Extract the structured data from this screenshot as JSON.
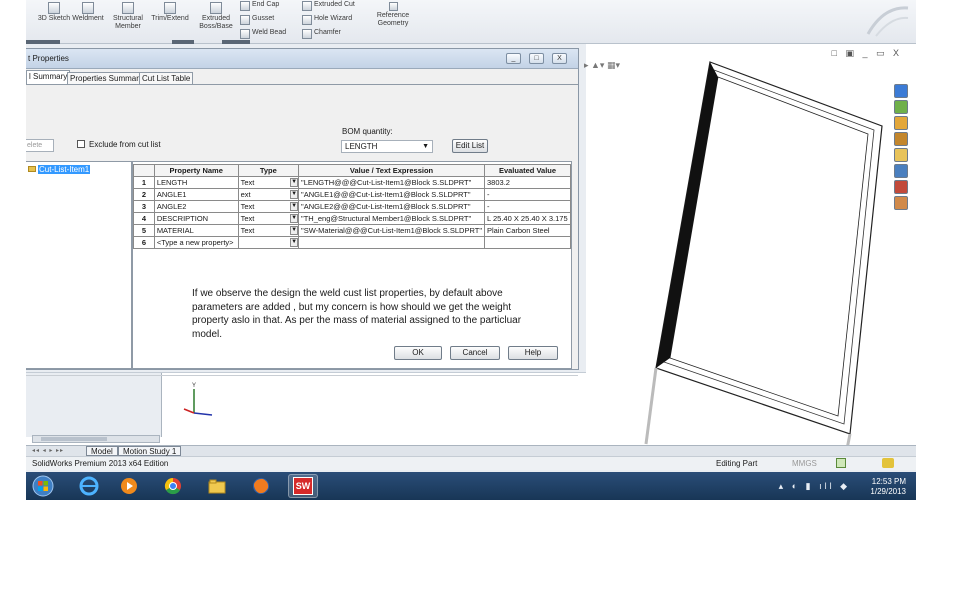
{
  "ribbon": {
    "buttons": [
      {
        "label": "3D Sketch",
        "icon": "sketch-3d-icon"
      },
      {
        "label": "Weldment",
        "icon": "weldment-icon"
      },
      {
        "label": "Structural Member",
        "icon": "structural-member-icon"
      },
      {
        "label": "Trim/Extend",
        "icon": "trim-extend-icon"
      },
      {
        "label": "Extruded Boss/Base",
        "icon": "extruded-boss-icon"
      }
    ],
    "small_col1": [
      "End Cap",
      "Gusset",
      "Weld Bead"
    ],
    "small_col2": [
      "Extruded Cut",
      "Hole Wizard",
      "Chamfer"
    ],
    "reference_geometry": "Reference Geometry"
  },
  "dialog": {
    "title": "t Properties",
    "tabs": [
      "l Summary",
      "Properties Summary",
      "Cut List Table"
    ],
    "delete_label": "elete",
    "exclude_label": "Exclude from cut list",
    "bom_quantity_label": "BOM quantity:",
    "bom_quantity_value": "LENGTH",
    "edit_list": "Edit List",
    "tree_item": "Cut-List-Item1",
    "columns": [
      "",
      "Property Name",
      "Type",
      "Value / Text Expression",
      "Evaluated Value"
    ],
    "rows": [
      {
        "num": "1",
        "name": "LENGTH",
        "type": "Text",
        "value": "\"LENGTH@@@Cut-List-Item1@Block S.SLDPRT\"",
        "evaluated": "3803.2"
      },
      {
        "num": "2",
        "name": "ANGLE1",
        "type": "ext",
        "value": "\"ANGLE1@@@Cut-List-Item1@Block S.SLDPRT\"",
        "evaluated": "-"
      },
      {
        "num": "3",
        "name": "ANGLE2",
        "type": "Text",
        "value": "\"ANGLE2@@@Cut-List-Item1@Block S.SLDPRT\"",
        "evaluated": "-"
      },
      {
        "num": "4",
        "name": "DESCRIPTION",
        "type": "Text",
        "value": "\"TH_eng@Structural Member1@Block S.SLDPRT\"",
        "evaluated": "L 25.40 X 25.40 X 3.175"
      },
      {
        "num": "5",
        "name": "MATERIAL",
        "type": "Text",
        "value": "\"SW-Material@@@Cut-List-Item1@Block S.SLDPRT\"",
        "evaluated": "Plain Carbon Steel"
      },
      {
        "num": "6",
        "name": "<Type a new property>",
        "type": "",
        "value": "",
        "evaluated": ""
      }
    ],
    "note": "If we observe the design the weld cust list properties, by default above parameters are added , but my concern is how should we get the weight property aslo in that. As per the mass of material assigned to the particluar model.",
    "ok": "OK",
    "cancel": "Cancel",
    "help": "Help",
    "window_buttons": [
      "_",
      "□",
      "X"
    ]
  },
  "model_tabs": [
    "Model",
    "Motion Study 1"
  ],
  "status": {
    "product": "SolidWorks Premium 2013 x64 Edition",
    "mode": "Editing Part",
    "units": "MMGS"
  },
  "taskbar": {
    "time": "12:53 PM",
    "date": "1/29/2013",
    "sw_label": "SW"
  },
  "graphics": {
    "viewport_controls": "□ ▣ _ ▭ X"
  },
  "colors": {
    "selection": "#3399ff",
    "taskbar": "#1f4067",
    "dialog_title": "#c3d3e6"
  }
}
